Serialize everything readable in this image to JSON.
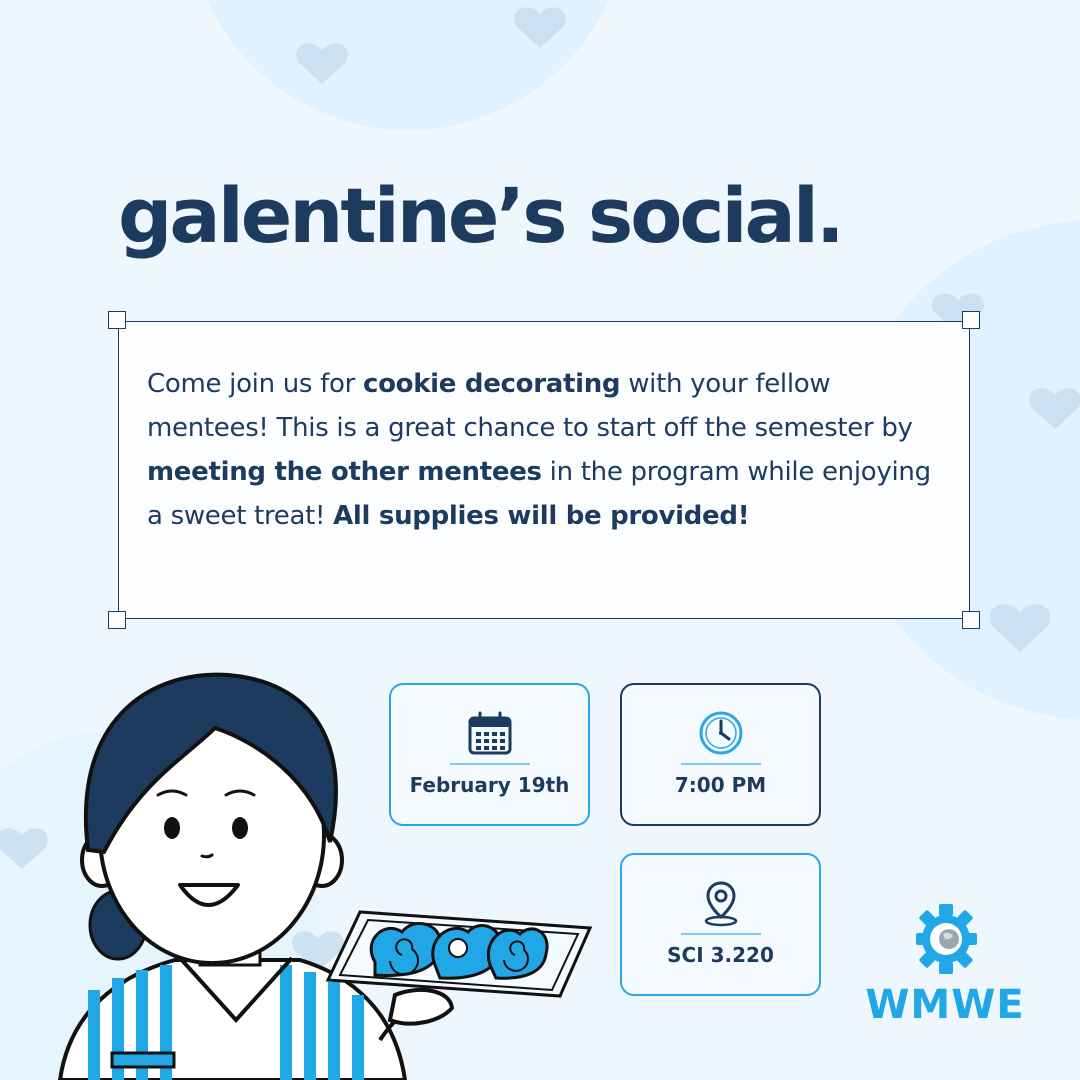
{
  "title": "galentine’s social.",
  "description": {
    "t1": "Come join us for ",
    "b1": "cookie decorating",
    "t2": " with your fellow mentees! This is a great chance to start off the semester by ",
    "b2": "meeting the other mentees",
    "t3": " in the program while enjoying a sweet treat! ",
    "b3": "All supplies will be provided!"
  },
  "details": {
    "date": {
      "label": "February 19th",
      "icon": "calendar-icon"
    },
    "time": {
      "label": "7:00 PM",
      "icon": "clock-icon"
    },
    "location": {
      "label": "SCI 3.220",
      "icon": "location-pin-icon"
    }
  },
  "logo": {
    "text": "WMWE",
    "icon": "gear-globe-icon"
  },
  "colors": {
    "navy": "#1d3a5f",
    "accent_blue": "#22a7e6",
    "background": "#eef7fd"
  }
}
